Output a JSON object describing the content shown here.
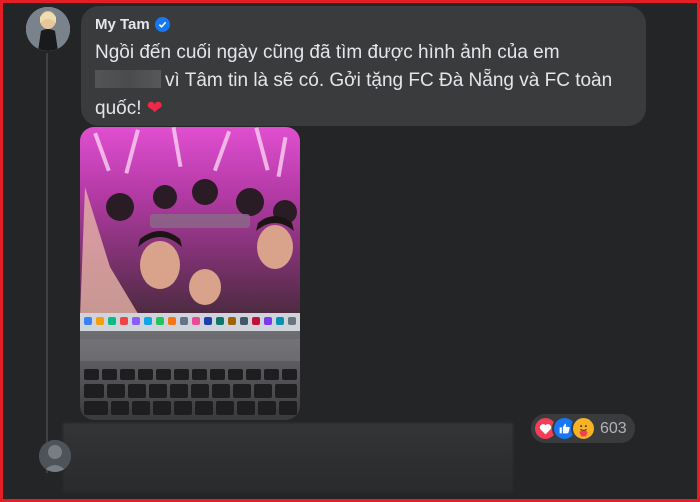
{
  "comment": {
    "author": "My Tam",
    "verified": true,
    "text_line_1": "Ngồi đến cuối ngày cũng đã tìm được hình ảnh của em",
    "text_line_2_after_redaction": "vì Tâm tin là sẽ có. Gởi tặng FC Đà Nẵng và FC toàn",
    "text_line_3": "quốc!",
    "emoji": "❤"
  },
  "reactions": {
    "icons": [
      "love-icon",
      "like-icon",
      "care-icon"
    ],
    "count": "603",
    "colors": {
      "love": "#f33e58",
      "like": "#1877f2",
      "care": "#f7b125"
    }
  },
  "photo": {
    "subject": "laptop-screen-concert-crowd"
  },
  "theme": {
    "background": "#242526",
    "bubble": "#3a3b3c",
    "text": "#e4e6eb",
    "verified": "#1877f2",
    "frame": "#e41e26"
  }
}
